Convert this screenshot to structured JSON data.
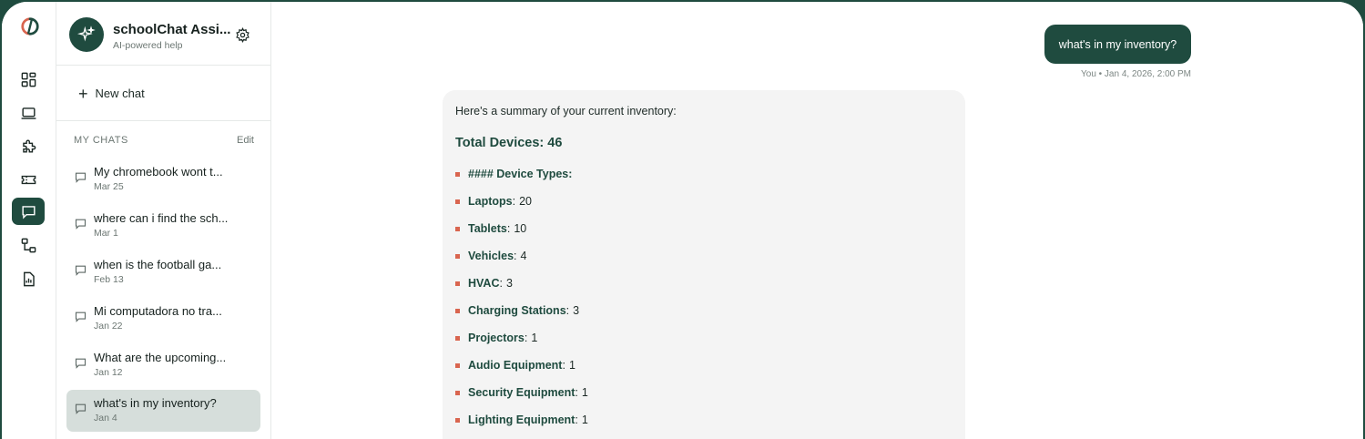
{
  "app": {
    "title": "schoolChat Assi...",
    "subtitle": "AI-powered help"
  },
  "rail": {
    "items": [
      {
        "icon": "dashboard-icon"
      },
      {
        "icon": "laptop-icon"
      },
      {
        "icon": "puzzle-icon"
      },
      {
        "icon": "ticket-icon"
      },
      {
        "icon": "chat-icon",
        "active": true
      },
      {
        "icon": "workflow-icon"
      },
      {
        "icon": "report-icon"
      }
    ]
  },
  "sidebar": {
    "new_chat_label": "New chat",
    "section_title": "MY CHATS",
    "edit_label": "Edit",
    "chats": [
      {
        "title": "My chromebook wont t...",
        "date": "Mar 25"
      },
      {
        "title": "where can i find the sch...",
        "date": "Mar 1"
      },
      {
        "title": "when is the football ga...",
        "date": "Feb 13"
      },
      {
        "title": "Mi computadora no tra...",
        "date": "Jan 22"
      },
      {
        "title": "What are the upcoming...",
        "date": "Jan 12"
      },
      {
        "title": "what's in my inventory?",
        "date": "Jan 4",
        "active": true
      }
    ]
  },
  "conversation": {
    "user_message": "what's in my inventory?",
    "user_meta": "You • Jan 4, 2026, 2:00 PM",
    "assistant": {
      "intro": "Here's a summary of your current inventory:",
      "total": "Total Devices: 46",
      "items": [
        {
          "label": "#### Device Types:",
          "value": ""
        },
        {
          "label": "Laptops",
          "value": "20"
        },
        {
          "label": "Tablets",
          "value": "10"
        },
        {
          "label": "Vehicles",
          "value": "4"
        },
        {
          "label": "HVAC",
          "value": "3"
        },
        {
          "label": "Charging Stations",
          "value": "3"
        },
        {
          "label": "Projectors",
          "value": "1"
        },
        {
          "label": "Audio Equipment",
          "value": "1"
        },
        {
          "label": "Security Equipment",
          "value": "1"
        },
        {
          "label": "Lighting Equipment",
          "value": "1"
        }
      ]
    }
  },
  "colors": {
    "brand": "#1f4b3f",
    "bullet": "#d9654f",
    "active_chat_bg": "#d6dedb",
    "assistant_bg": "#f4f4f4"
  }
}
